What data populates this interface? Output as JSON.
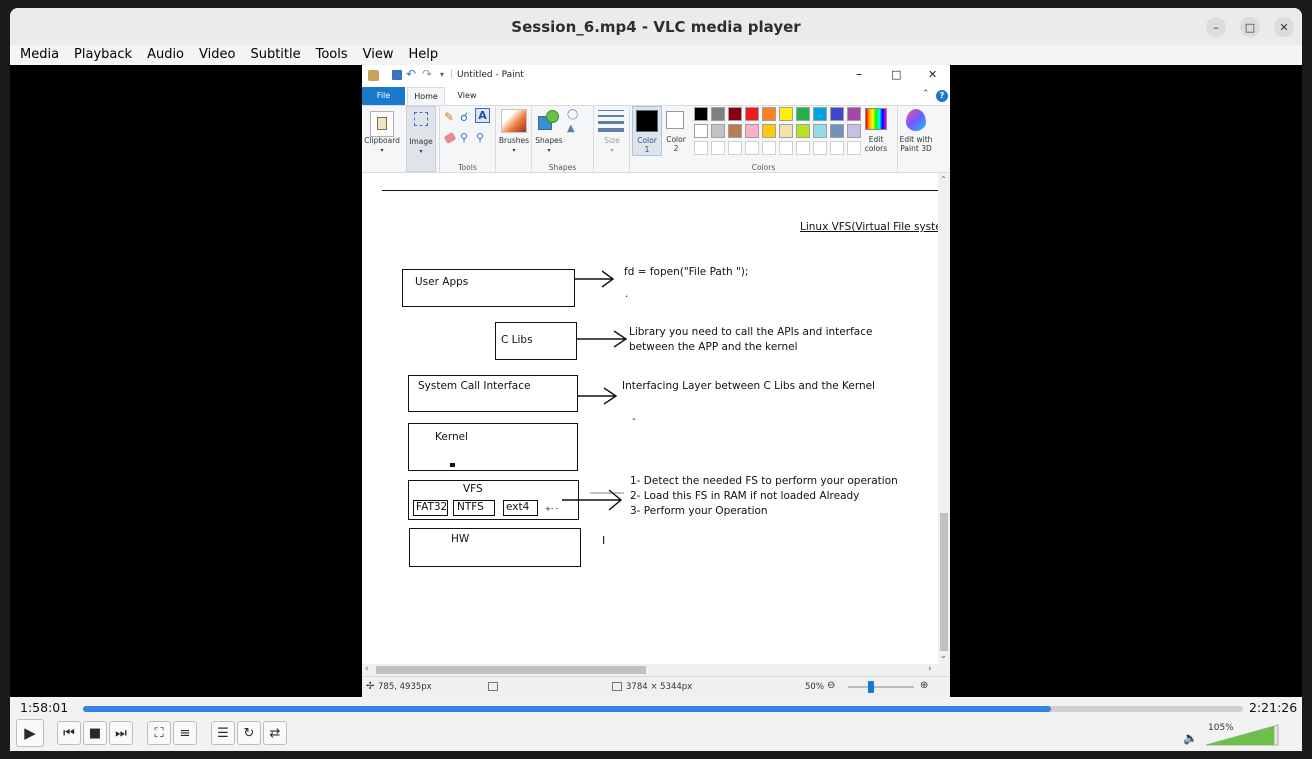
{
  "window": {
    "title": "Session_6.mp4 - VLC media player"
  },
  "menu": [
    "Media",
    "Playback",
    "Audio",
    "Video",
    "Subtitle",
    "Tools",
    "View",
    "Help"
  ],
  "paint": {
    "title": "Untitled - Paint",
    "tabs": [
      "File",
      "Home",
      "View"
    ],
    "ribbon": {
      "clipboard": "Clipboard",
      "image": "Image",
      "tools": "Tools",
      "brushes": "Brushes",
      "shapes_btn": "Shapes",
      "shapes_group": "Shapes",
      "size": "Size",
      "color1": [
        "Color",
        "1"
      ],
      "color2": [
        "Color",
        "2"
      ],
      "colors": "Colors",
      "edit_colors": [
        "Edit",
        "colors"
      ],
      "edit_paint3d": [
        "Edit with",
        "Paint 3D"
      ]
    },
    "palette_row1": [
      "#000000",
      "#7f7f7f",
      "#880015",
      "#ed1c24",
      "#ff7f27",
      "#fff200",
      "#22b14c",
      "#00a2e8",
      "#3f48cc",
      "#a349a4"
    ],
    "palette_row2": [
      "#ffffff",
      "#c3c3c3",
      "#b97a57",
      "#ffaec9",
      "#ffc90e",
      "#efe4b0",
      "#b5e61d",
      "#99d9ea",
      "#7092be",
      "#c8bfe7"
    ],
    "canvas": {
      "header": "Linux VFS(Virtual File systen",
      "user_apps": "User Apps",
      "fopen": "fd = fopen(\"File Path \");",
      "dot1": ".",
      "c_libs": "C Libs",
      "clib_desc1": "Library you need to call the APIs and interface",
      "clib_desc2": "between the APP and the kernel",
      "syscall": "System Call Interface",
      "syscall_desc": "Interfacing Layer between C Libs and the Kernel",
      "dash": "-",
      "kernel": "Kernel",
      "vfs": "VFS",
      "fat32": "FAT32",
      "ntfs": "NTFS",
      "ext4": "ext4",
      "vfs_small": "+-  -",
      "vfs_step1": "1- Detect the needed FS to perform your operation",
      "vfs_step2": "2- Load this FS in RAM if not loaded Already",
      "vfs_step3": "3- Perform your Operation",
      "hw": "HW",
      "cursor": "I"
    },
    "status": {
      "position": "785, 4935px",
      "size": "3784 × 5344px",
      "zoom": "50%",
      "zoom_level": 0.33
    }
  },
  "player": {
    "elapsed": "1:58:01",
    "total": "2:21:26",
    "progress": 0.8345,
    "volume": "105%",
    "volume_level": 0.95
  }
}
